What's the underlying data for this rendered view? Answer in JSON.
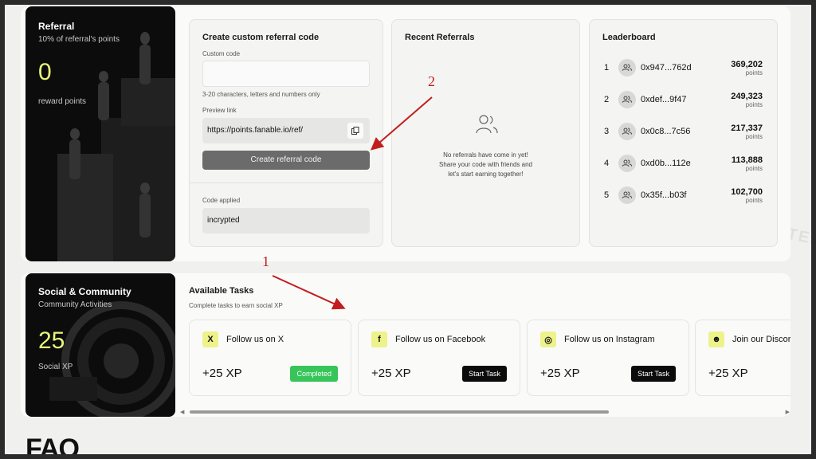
{
  "referral": {
    "title": "Referral",
    "subtitle": "10% of referral's points",
    "value": "0",
    "value_label": "reward points"
  },
  "create_code": {
    "title": "Create custom referral code",
    "custom_code_label": "Custom code",
    "custom_code_value": "",
    "hint": "3-20 characters, letters and numbers only",
    "preview_label": "Preview link",
    "preview_url": "https://points.fanable.io/ref/",
    "button_label": "Create referral code",
    "applied_label": "Code applied",
    "applied_value": "incrypted"
  },
  "recent_referrals": {
    "title": "Recent Referrals",
    "empty_lines": [
      "No referrals have come in yet!",
      "Share your code with friends and",
      "let's start earning together!"
    ]
  },
  "leaderboard": {
    "title": "Leaderboard",
    "rows": [
      {
        "rank": "1",
        "address": "0x947...762d",
        "points": "369,202",
        "unit": "points"
      },
      {
        "rank": "2",
        "address": "0xdef...9f47",
        "points": "249,323",
        "unit": "points"
      },
      {
        "rank": "3",
        "address": "0x0c8...7c56",
        "points": "217,337",
        "unit": "points"
      },
      {
        "rank": "4",
        "address": "0xd0b...112e",
        "points": "113,888",
        "unit": "points"
      },
      {
        "rank": "5",
        "address": "0x35f...b03f",
        "points": "102,700",
        "unit": "points"
      }
    ]
  },
  "social": {
    "title": "Social & Community",
    "subtitle": "Community Activities",
    "value": "25",
    "value_label": "Social XP"
  },
  "tasks": {
    "title": "Available Tasks",
    "subtitle": "Complete tasks to earn social XP",
    "items": [
      {
        "name": "Follow us on X",
        "xp": "+25 XP",
        "button": "Completed",
        "icon": "x-logo-icon",
        "glyph": "X"
      },
      {
        "name": "Follow us on Facebook",
        "xp": "+25 XP",
        "button": "Start Task",
        "icon": "facebook-icon",
        "glyph": "f"
      },
      {
        "name": "Follow us on Instagram",
        "xp": "+25 XP",
        "button": "Start Task",
        "icon": "instagram-icon",
        "glyph": "◎"
      },
      {
        "name": "Join our Discord",
        "xp": "+25 XP",
        "button": "",
        "icon": "discord-icon",
        "glyph": "☻"
      }
    ]
  },
  "faq": {
    "title": "FAQ"
  },
  "annotations": {
    "one": "1",
    "two": "2"
  },
  "watermark": "INCRYPTED",
  "colors": {
    "accent": "#e9f57b",
    "completed": "#37c55a",
    "annotation": "#c21d1d"
  }
}
